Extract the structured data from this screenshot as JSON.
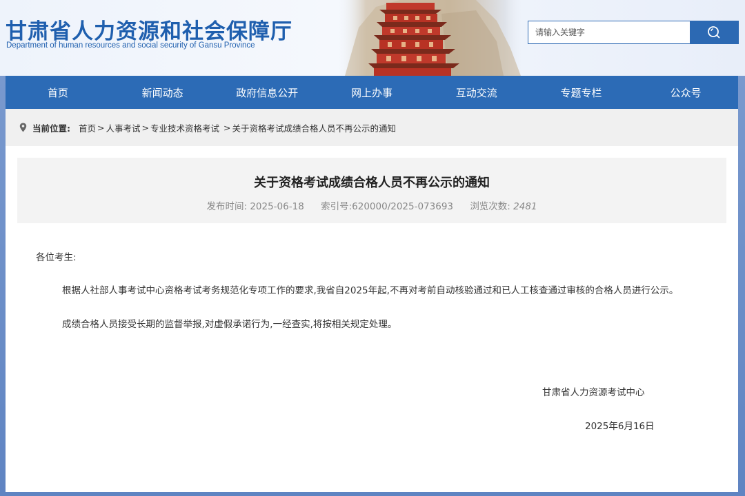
{
  "header": {
    "site_title": "甘肃省人力资源和社会保障厅",
    "site_subtitle": "Department of human resources and social security of Gansu Province"
  },
  "search": {
    "placeholder": "请输入关键字",
    "icon": "search-icon"
  },
  "nav": {
    "items": [
      "首页",
      "新闻动态",
      "政府信息公开",
      "网上办事",
      "互动交流",
      "专题专栏",
      "公众号"
    ]
  },
  "breadcrumb": {
    "label": "当前位置:",
    "crumbs": [
      "首页",
      "人事考试",
      "专业技术资格考试",
      "关于资格考试成绩合格人员不再公示的通知"
    ],
    "separator": ">"
  },
  "article": {
    "title": "关于资格考试成绩合格人员不再公示的通知",
    "publish_label": "发布时间:",
    "publish_date": "2025-06-18",
    "index_label": "索引号:",
    "index_no": "620000/2025-073693",
    "views_label": "浏览次数:",
    "views": "2481",
    "salutation": "各位考生:",
    "paragraphs": [
      "根据人社部人事考试中心资格考试考务规范化专项工作的要求,我省自2025年起,不再对考前自动核验通过和已人工核查通过审核的合格人员进行公示。",
      "成绩合格人员接受长期的监督举报,对虚假承诺行为,一经查实,将按相关规定处理。"
    ],
    "signature_org": "甘肃省人力资源考试中心",
    "signature_date": "2025年6月16日"
  },
  "colors": {
    "brand_blue": "#2c6bb6",
    "title_blue": "#1f5fae",
    "frame_blue": "#6d8fc7"
  }
}
